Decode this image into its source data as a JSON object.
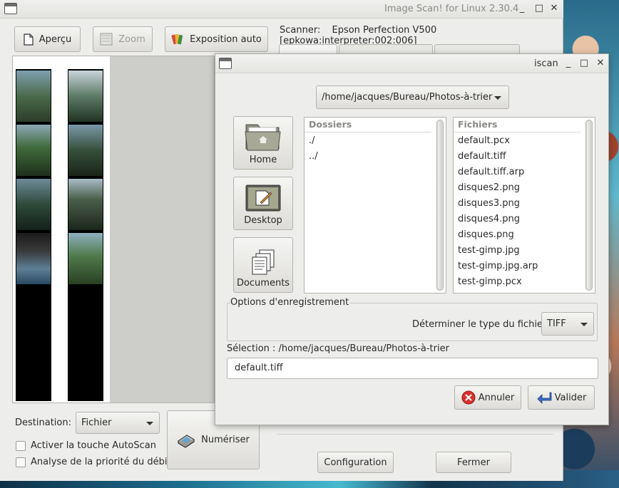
{
  "main_window": {
    "title": "Image Scan! for Linux 2.30.4",
    "controls": {
      "minimize": "_",
      "maximize": "□",
      "close": "✕"
    },
    "toolbar": {
      "preview_label": "Aperçu",
      "zoom_label": "Zoom",
      "auto_exposure_label": "Exposition auto"
    },
    "scanner": {
      "label": "Scanner:",
      "name": "Epson Perfection V500 [epkowa:interpreter:002:006]"
    },
    "destination": {
      "label": "Destination:",
      "value": "Fichier"
    },
    "checkboxes": [
      {
        "label": "Activer la touche AutoScan",
        "checked": false
      },
      {
        "label": "Analyse de la priorité du débit",
        "checked": false
      }
    ],
    "scan_button_label": "Numériser",
    "config_button_label": "Configuration",
    "close_button_label": "Fermer"
  },
  "dialog": {
    "title": "iscan",
    "controls": {
      "minimize": "_",
      "maximize": "□",
      "close": "✕"
    },
    "path_value": "/home/jacques/Bureau/Photos-à-trier",
    "places": [
      {
        "label": "Home",
        "icon": "home-folder-icon"
      },
      {
        "label": "Desktop",
        "icon": "desktop-icon"
      },
      {
        "label": "Documents",
        "icon": "documents-icon"
      }
    ],
    "folders": {
      "header": "Dossiers",
      "items": [
        "./",
        "../"
      ]
    },
    "files": {
      "header": "Fichiers",
      "items": [
        "default.pcx",
        "default.tiff",
        "default.tiff.arp",
        "disques2.png",
        "disques3.png",
        "disques4.png",
        "disques.png",
        "test-gimp.jpg",
        "test-gimp.jpg.arp",
        "test-gimp.pcx"
      ]
    },
    "options": {
      "legend": "Options d'enregistrement",
      "file_type_label": "Déterminer le type du fichier:",
      "file_type_value": "TIFF"
    },
    "selection_label": "Sélection : /home/jacques/Bureau/Photos-à-trier",
    "filename_value": "default.tiff",
    "cancel_label": "Annuler",
    "ok_label": "Valider"
  },
  "colors": {
    "window_bg": "#ededeb",
    "cancel_icon": "#d9302b",
    "ok_icon": "#3b6fc4"
  }
}
